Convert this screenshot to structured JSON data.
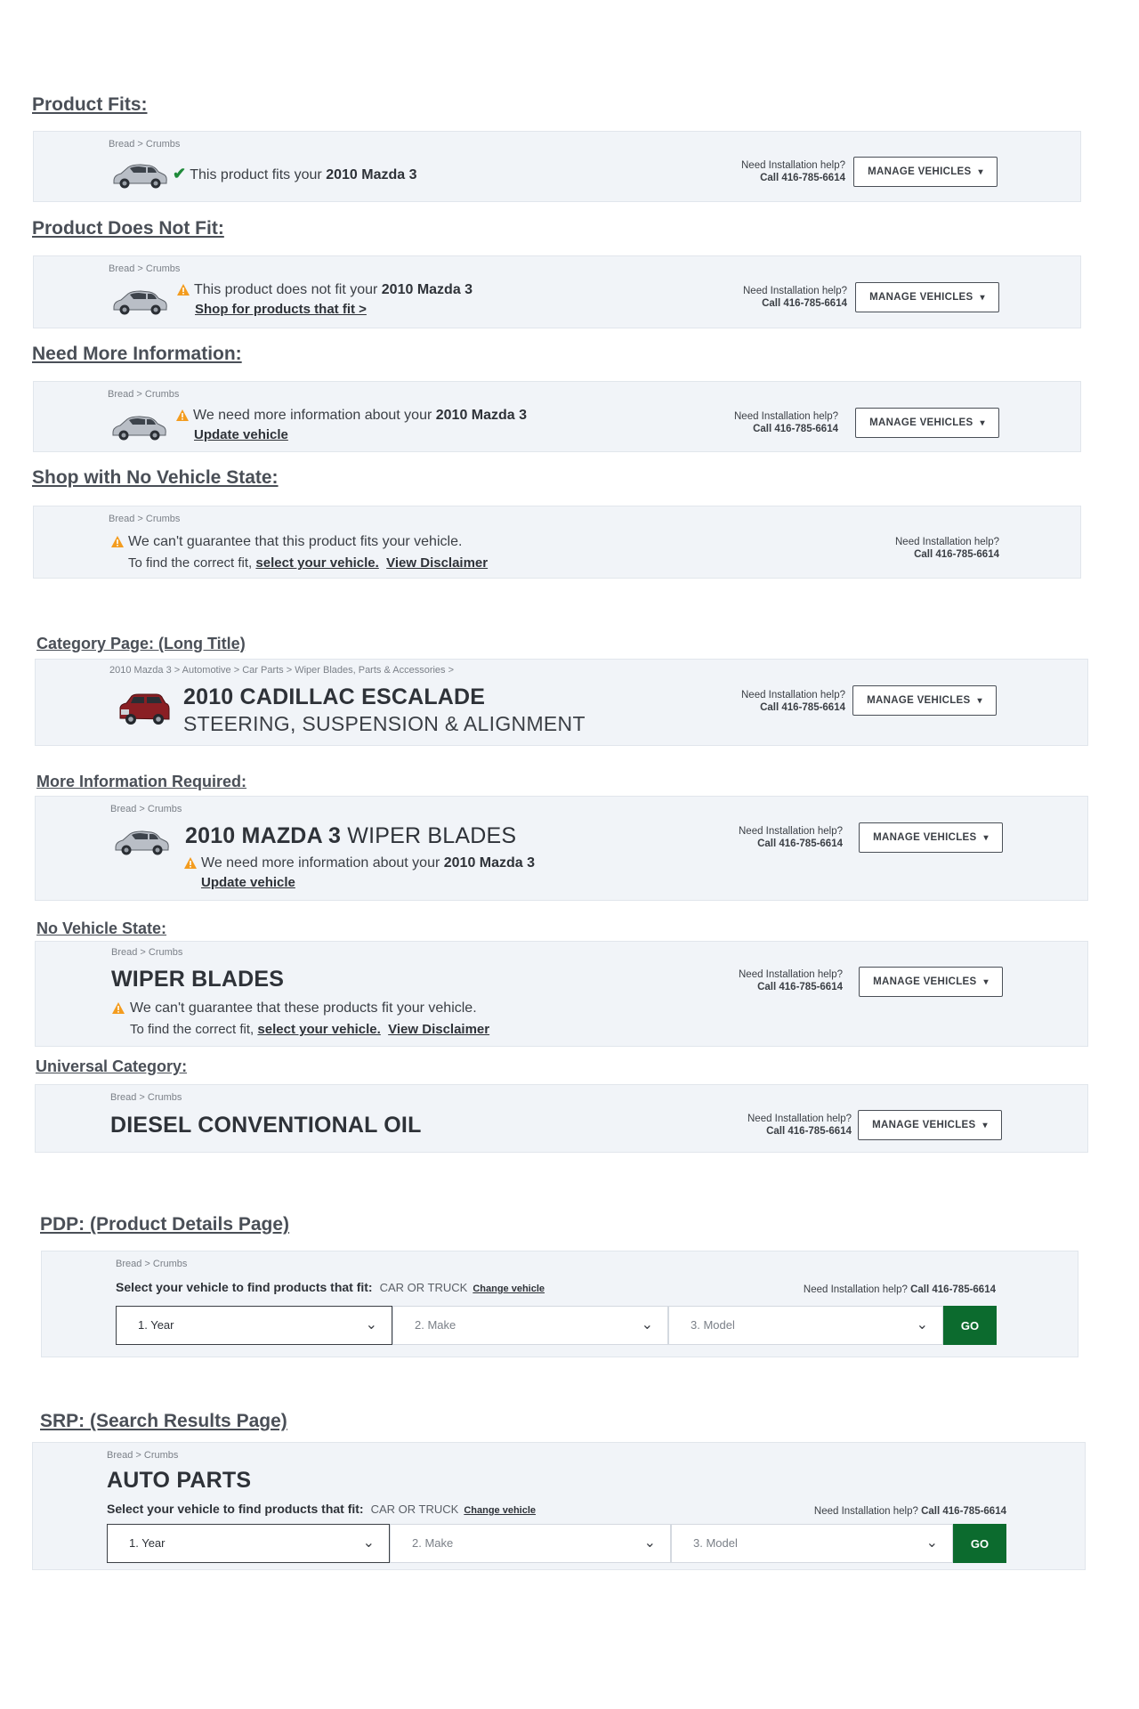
{
  "common": {
    "breadcrumb": "Bread > Crumbs",
    "help_label": "Need Installation help?",
    "help_phone": "Call 416-785-6614",
    "help_inline": "Need Installation help?",
    "help_inline_phone": "Call 416-785-6614",
    "manage_vehicles": "MANAGE VEHICLES",
    "vehicle": "2010 Mazda 3"
  },
  "s1": {
    "heading": "Product Fits:",
    "msg_prefix": "This product fits your "
  },
  "s2": {
    "heading": "Product Does Not Fit:",
    "msg_prefix": "This product does not fit your ",
    "link": "Shop for products that fit >"
  },
  "s3": {
    "heading": "Need More Information:",
    "msg_prefix": "We need more information about your ",
    "link": "Update vehicle"
  },
  "s4": {
    "heading": "Shop with No Vehicle State:",
    "msg": "We can't guarantee that this product fits your vehicle.",
    "line2_prefix": "To find the correct fit, ",
    "select_link": "select your vehicle.",
    "disclaimer_link": "View Disclaimer"
  },
  "s5": {
    "heading": "Category Page: (Long Title)",
    "breadcrumb": "2010  Mazda 3 > Automotive > Car Parts > Wiper Blades, Parts & Accessories >",
    "title": "2010 CADILLAC ESCALADE",
    "subtitle": "STEERING, SUSPENSION & ALIGNMENT"
  },
  "s6": {
    "heading": "More Information Required:",
    "title_bold": "2010 MAZDA 3",
    "title_light": " WIPER BLADES",
    "msg_prefix": "We need more information about your ",
    "link": "Update vehicle"
  },
  "s7": {
    "heading": "No Vehicle State:",
    "title": "WIPER BLADES",
    "msg": "We can't guarantee that these products fit your vehicle.",
    "line2_prefix": "To find the correct fit, ",
    "select_link": "select your vehicle.",
    "disclaimer_link": "View Disclaimer"
  },
  "s8": {
    "heading": "Universal Category:",
    "title": "DIESEL CONVENTIONAL OIL"
  },
  "s9": {
    "heading": "PDP: (Product Details Page)",
    "prompt": "Select your vehicle to find products that fit:",
    "vehicle_type": "CAR OR TRUCK",
    "change": "Change vehicle",
    "year": "1.  Year",
    "make": "2.  Make",
    "model": "3.  Model",
    "go": "GO"
  },
  "s10": {
    "heading": "SRP: (Search Results Page)",
    "title": "AUTO PARTS",
    "prompt": "Select your vehicle to find products that fit:",
    "vehicle_type": "CAR OR TRUCK",
    "change": "Change vehicle",
    "year": "1.  Year",
    "make": "2.  Make",
    "model": "3.  Model",
    "go": "GO"
  },
  "colors": {
    "panel_bg": "#f1f4f8",
    "go_green": "#0c6b2e",
    "check_green": "#1f8a3a",
    "warning_orange": "#f39c1f"
  },
  "icons": {
    "car": "car-icon",
    "check": "check-icon",
    "warning": "warning-icon",
    "chevron": "chevron-down-icon"
  }
}
